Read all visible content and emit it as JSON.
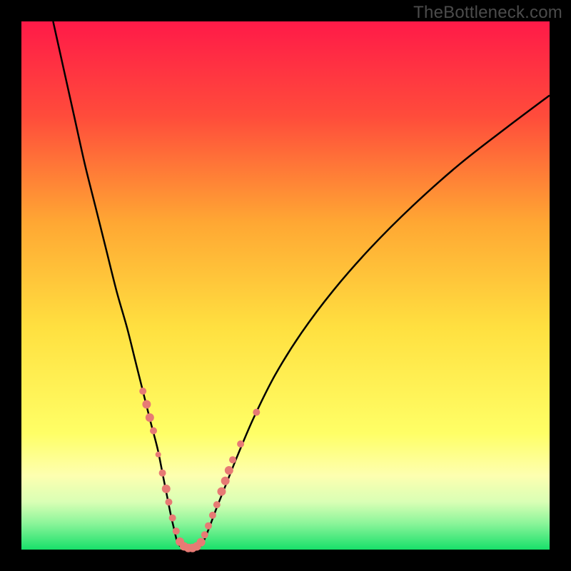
{
  "watermark": "TheBottleneck.com",
  "chart_data": {
    "type": "line",
    "title": "",
    "xlabel": "",
    "ylabel": "",
    "xlim": [
      0,
      100
    ],
    "ylim": [
      0,
      100
    ],
    "gradient": {
      "stops": [
        {
          "pct": 0,
          "color": "#ff1a48"
        },
        {
          "pct": 18,
          "color": "#ff4c3b"
        },
        {
          "pct": 38,
          "color": "#ffa733"
        },
        {
          "pct": 58,
          "color": "#ffe040"
        },
        {
          "pct": 78,
          "color": "#ffff66"
        },
        {
          "pct": 86,
          "color": "#fdffb0"
        },
        {
          "pct": 91,
          "color": "#d9ffb5"
        },
        {
          "pct": 95,
          "color": "#8cf59a"
        },
        {
          "pct": 100,
          "color": "#18e06a"
        }
      ]
    },
    "series": [
      {
        "name": "left-branch",
        "x": [
          6,
          8,
          10,
          12,
          14,
          16,
          18,
          20,
          21.5,
          23,
          24.5,
          25.8,
          26.8,
          27.6,
          28.3,
          29.0,
          29.6
        ],
        "values": [
          100,
          91,
          82,
          73,
          65,
          57,
          49,
          42,
          36,
          30,
          24,
          19,
          14,
          10,
          6.5,
          3.5,
          1.2
        ]
      },
      {
        "name": "valley",
        "x": [
          29.6,
          30.5,
          31.5,
          32.5,
          33.5,
          34.3
        ],
        "values": [
          1.2,
          0.4,
          0.15,
          0.15,
          0.4,
          1.2
        ]
      },
      {
        "name": "right-branch",
        "x": [
          34.3,
          35.5,
          37,
          39,
          41,
          44,
          48,
          53,
          59,
          66,
          74,
          83,
          92,
          100
        ],
        "values": [
          1.2,
          4,
          8,
          13,
          18,
          25,
          33,
          41,
          49,
          57,
          65,
          73,
          80,
          86
        ]
      }
    ],
    "scatter": {
      "name": "highlight-dots",
      "points": [
        {
          "x": 23.0,
          "y": 30.0,
          "r": 5
        },
        {
          "x": 23.7,
          "y": 27.5,
          "r": 6
        },
        {
          "x": 24.3,
          "y": 25.0,
          "r": 6
        },
        {
          "x": 25.0,
          "y": 22.5,
          "r": 5
        },
        {
          "x": 25.9,
          "y": 18.0,
          "r": 4
        },
        {
          "x": 26.7,
          "y": 14.5,
          "r": 5
        },
        {
          "x": 27.4,
          "y": 11.5,
          "r": 6
        },
        {
          "x": 27.9,
          "y": 9.0,
          "r": 5
        },
        {
          "x": 28.6,
          "y": 6.0,
          "r": 5
        },
        {
          "x": 29.3,
          "y": 3.5,
          "r": 5
        },
        {
          "x": 30.0,
          "y": 1.5,
          "r": 6
        },
        {
          "x": 30.8,
          "y": 0.6,
          "r": 6
        },
        {
          "x": 31.6,
          "y": 0.3,
          "r": 6
        },
        {
          "x": 32.4,
          "y": 0.3,
          "r": 6
        },
        {
          "x": 33.2,
          "y": 0.6,
          "r": 6
        },
        {
          "x": 34.0,
          "y": 1.4,
          "r": 6
        },
        {
          "x": 34.7,
          "y": 2.8,
          "r": 5
        },
        {
          "x": 35.4,
          "y": 4.5,
          "r": 5
        },
        {
          "x": 36.2,
          "y": 6.5,
          "r": 5
        },
        {
          "x": 37.0,
          "y": 8.5,
          "r": 5
        },
        {
          "x": 37.9,
          "y": 11.0,
          "r": 6
        },
        {
          "x": 38.6,
          "y": 13.0,
          "r": 6
        },
        {
          "x": 39.3,
          "y": 15.0,
          "r": 6
        },
        {
          "x": 40.0,
          "y": 17.0,
          "r": 5
        },
        {
          "x": 41.5,
          "y": 20.0,
          "r": 5
        },
        {
          "x": 44.5,
          "y": 26.0,
          "r": 5
        }
      ]
    }
  }
}
